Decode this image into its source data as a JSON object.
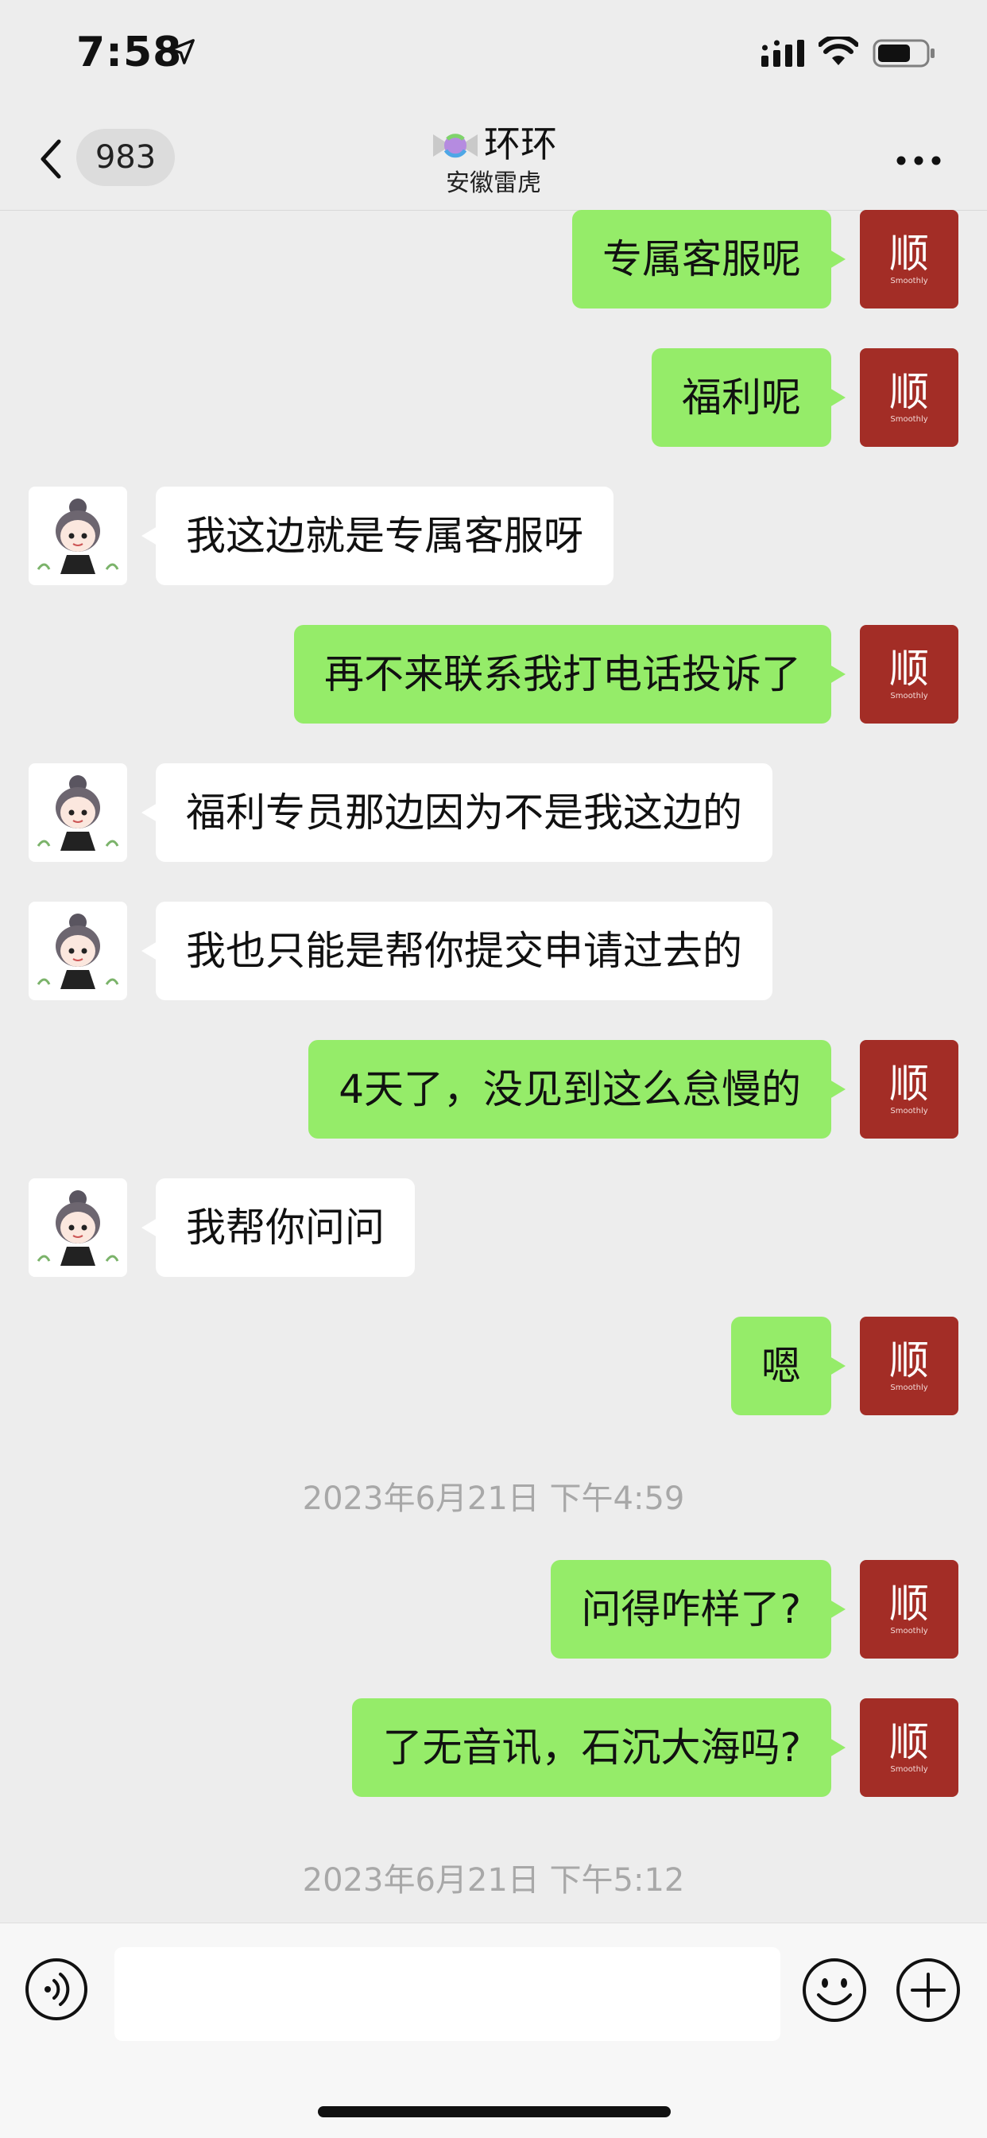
{
  "status_bar": {
    "time": "7:58"
  },
  "nav": {
    "unread_count": "983",
    "contact_name": "环环",
    "contact_subtitle": "安徽雷虎"
  },
  "avatars": {
    "self_logo_text": "顺",
    "self_logo_subtext": "Smoothly"
  },
  "messages": [
    {
      "sender": "self",
      "text": "专属客服呢"
    },
    {
      "sender": "self",
      "text": "福利呢"
    },
    {
      "sender": "other",
      "text": "我这边就是专属客服呀"
    },
    {
      "sender": "self",
      "text": "再不来联系我打电话投诉了"
    },
    {
      "sender": "other",
      "text": "福利专员那边因为不是我这边的"
    },
    {
      "sender": "other",
      "text": "我也只能是帮你提交申请过去的"
    },
    {
      "sender": "self",
      "text": "4天了，没见到这么怠慢的"
    },
    {
      "sender": "other",
      "text": "我帮你问问"
    },
    {
      "sender": "self",
      "text": "嗯"
    },
    {
      "sender": "self",
      "text": "问得咋样了?"
    },
    {
      "sender": "self",
      "text": "了无音讯，石沉大海吗?"
    }
  ],
  "timestamps": [
    "2023年6月21日 下午4:59",
    "2023年6月21日 下午5:12"
  ],
  "colors": {
    "self_bubble": "#95ec69",
    "other_bubble": "#ffffff",
    "background": "#ededed",
    "self_avatar": "#a32d26"
  }
}
